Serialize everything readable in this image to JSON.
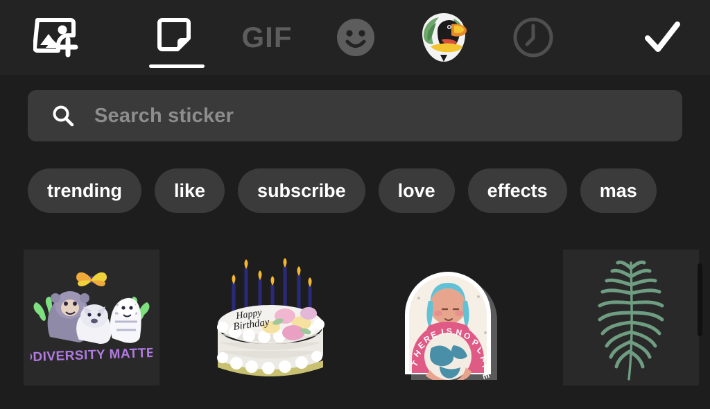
{
  "app": {
    "name": "Sticker picker",
    "background_color": "#1d1d1d",
    "toolbar_background": "#232323",
    "accent_color": "#ffffff",
    "inactive_color": "#5d5d5d"
  },
  "toolbar": {
    "items": [
      {
        "icon": "add-image-icon",
        "label": "Add image",
        "active": false,
        "state": "enabled"
      },
      {
        "icon": "sticker-icon",
        "label": "Sticker",
        "active": true,
        "state": "enabled"
      },
      {
        "icon": "gif-icon",
        "label": "GIF",
        "active": false,
        "state": "dimmed"
      },
      {
        "icon": "emoji-icon",
        "label": "Emoji",
        "active": false,
        "state": "dimmed"
      },
      {
        "icon": "toucan-sticker-icon",
        "label": "Toucan sticker",
        "active": false,
        "state": "enabled"
      },
      {
        "icon": "clock-icon",
        "label": "Recent",
        "active": false,
        "state": "dimmed"
      },
      {
        "icon": "check-icon",
        "label": "Done",
        "active": false,
        "state": "enabled"
      }
    ],
    "gif_label": "GIF"
  },
  "search": {
    "placeholder": "Search sticker",
    "value": "",
    "icon": "search-icon"
  },
  "categories": {
    "chips": [
      {
        "label": "trending"
      },
      {
        "label": "like"
      },
      {
        "label": "subscribe"
      },
      {
        "label": "love"
      },
      {
        "label": "effects"
      },
      {
        "label": "mas"
      }
    ]
  },
  "stickers": {
    "items": [
      {
        "name": "biodiversity-matters-sticker",
        "caption": "BIODIVERSITY MATTERS",
        "alt": "Gorilla, wolf and tiger with butterfly and leaves"
      },
      {
        "name": "birthday-cake-sticker",
        "caption": "Happy Birthday",
        "alt": "White frosted birthday cake with blue candles and pastel flowers"
      },
      {
        "name": "no-planet-b-sticker",
        "caption": "THERE IS NO PLANET B",
        "alt": "Girl with blue hair holding the Earth inside an arch badge"
      },
      {
        "name": "fern-leaf-sticker",
        "caption": "",
        "alt": "Green fern palm leaf"
      }
    ]
  },
  "scrollbar": {
    "orientation": "vertical",
    "position": "right"
  }
}
